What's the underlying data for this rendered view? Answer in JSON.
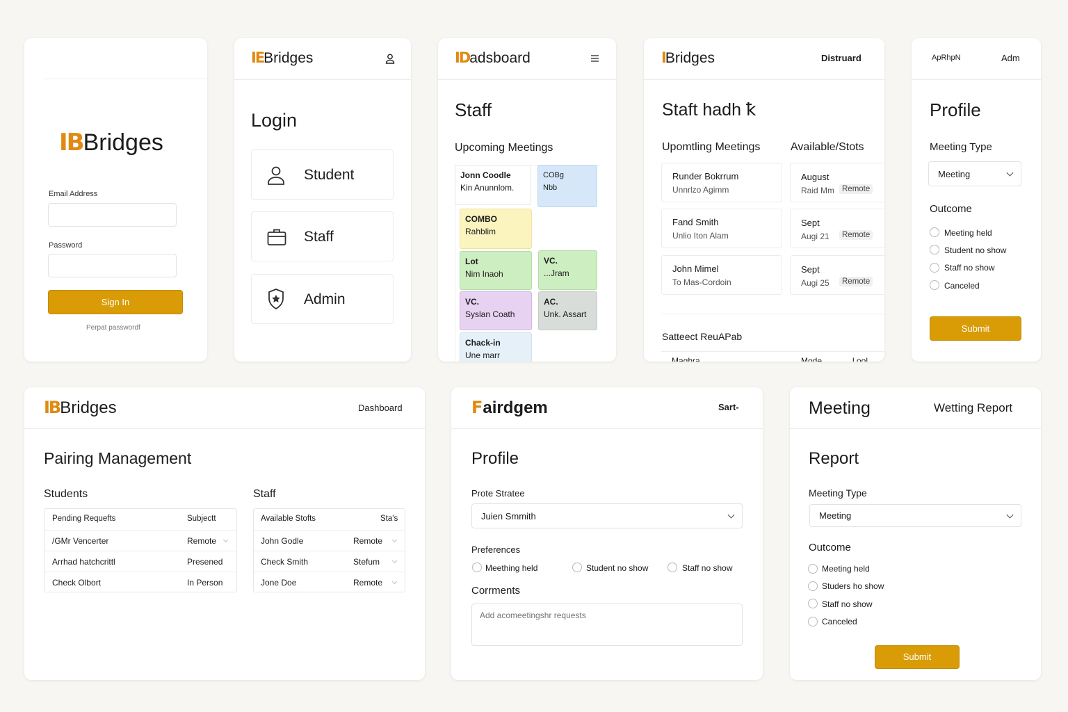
{
  "login_screen": {
    "logo_mark": "IB",
    "brand": "Bridges",
    "email_label": "Email Address",
    "password_label": "Password",
    "sign_in": "Sign In",
    "forgot": "Perpat passwordf"
  },
  "role_screen": {
    "logo_mark": "IE",
    "brand": "Bridges",
    "title": "Login",
    "roles": [
      "Student",
      "Staff",
      "Admin"
    ]
  },
  "staff_dashboard": {
    "logo_mark": "ID",
    "brand": "adsboard",
    "title": "Staff",
    "section": "Upcoming  Meetings",
    "cells": [
      {
        "title": "Jonn Coodle",
        "sub": "Kin Anunnlom."
      },
      {
        "title": "COBg",
        "sub": "Nbb"
      },
      {
        "title": "COMBO",
        "sub": "Rahblim"
      },
      {
        "title": "Lot",
        "sub": "Nim Inaoh"
      },
      {
        "title": "VC.",
        "sub": "...Jram"
      },
      {
        "title": "VC.",
        "sub": "Syslan Coath"
      },
      {
        "title": "AC.",
        "sub": "Unk. Assart"
      },
      {
        "title": "Chack-in",
        "sub": "Une marr"
      }
    ]
  },
  "staff_schedule": {
    "logo_mark": "I",
    "brand": "Bridges",
    "nav": "Distruard",
    "title": "Staft hadh ꝁ",
    "upcoming_label": "Upomtling  Meetings",
    "slots_label": "Available/Stots",
    "meetings": [
      {
        "name": "Runder Bokrrum",
        "sub": "Unnrlzo Agimm"
      },
      {
        "name": "Fand Smith",
        "sub": "Unlio Iton Alam"
      },
      {
        "name": "John Mimel",
        "sub": "To Mas-Cordoin"
      }
    ],
    "slots": [
      {
        "month": "August",
        "date": "Raid Mm",
        "mode": "Remote"
      },
      {
        "month": "Sept",
        "date": "Augi 21",
        "mode": "Remote"
      },
      {
        "month": "Sept",
        "date": "Augi 25",
        "mode": "Remote"
      }
    ],
    "footer_label": "Satteect ReuAPab",
    "footer_cols": [
      "Maghra",
      "Mode",
      "l ool"
    ]
  },
  "profile_small": {
    "header_left": "ApRhpN",
    "header_right": "Adm",
    "title": "Profile",
    "meeting_type_label": "Meeting Type",
    "meeting_type_value": "Meeting",
    "outcome_label": "Outcome",
    "options": [
      "Meeting held",
      "Student no show",
      "Staff no show",
      "Canceled"
    ],
    "submit": "Submit"
  },
  "pairing": {
    "logo_mark": "IB",
    "brand": "Bridges",
    "nav": "Dashboard",
    "title": "Pairing Management",
    "students_label": "Students",
    "staff_label": "Staff",
    "students_headers": [
      "Pending Requefts",
      "Subjectt"
    ],
    "students_rows": [
      {
        "name": "/GMr Vencerter",
        "mode": "Remote"
      },
      {
        "name": "Arrhad hatchcrittl",
        "mode": "Presened"
      },
      {
        "name": "Check Olbort",
        "mode": "In Person"
      }
    ],
    "staff_headers": [
      "Available Stofts",
      "Sta's"
    ],
    "staff_rows": [
      {
        "name": "John Godle",
        "mode": "Remote"
      },
      {
        "name": "Check Smith",
        "mode": "Stefum"
      },
      {
        "name": "Jone Doe",
        "mode": "Remote"
      }
    ]
  },
  "profile_wide": {
    "logo_mark": "F",
    "brand": "airdgem",
    "nav": "Sart-",
    "title": "Profile",
    "select_label": "Prote Stratee",
    "select_value": "Juien Smmith",
    "preferences_label": "Preferences",
    "prefs": [
      "Meething held",
      "Student no show",
      "Staff no show"
    ],
    "comments_label": "Corrments",
    "comments_placeholder": "Add acomeetingshr requests"
  },
  "meeting_report": {
    "header_left": "Meeting",
    "header_right": "Wetting Report",
    "title": "Report",
    "meeting_type_label": "Meeting Type",
    "meeting_type_value": "Meeting",
    "outcome_label": "Outcome",
    "options": [
      "Meeting held",
      "Studers ho show",
      "Staff no show",
      "Canceled"
    ],
    "submit": "Submit"
  },
  "colors": {
    "accent": "#d99c06",
    "logo": "#e08a12",
    "cell_blue": "#d5e7f8",
    "cell_yellow": "#fbf4bf",
    "cell_green": "#cdeec0",
    "cell_purple": "#e7d2f2",
    "cell_gray": "#d8ddd9"
  }
}
